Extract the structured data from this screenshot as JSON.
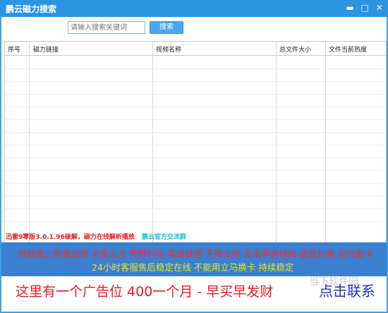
{
  "window": {
    "title": "鹏云磁力搜索",
    "minimize_glyph": "▬",
    "maximize_glyph": "□",
    "close_glyph": "✕"
  },
  "search": {
    "placeholder": "请输入搜索关键词",
    "button_label": "搜索"
  },
  "table": {
    "columns": [
      "序号",
      "磁力链接",
      "视频名称",
      "总文件大小",
      "文件当前热度"
    ],
    "rows": []
  },
  "info": {
    "version_note": "迅雷9零版3.0.1.96破解，磁力在线解析播放",
    "group_link": "鹏云官方交流群"
  },
  "banner": {
    "line1": "终结者2  刺激战场  全军出击  荒野行动  英雄联盟  无限法则  安卓手游辅助-最低价格  总代批卡",
    "line2": "24小时客服售后稳定在线    不能用立马换卡  持续稳定"
  },
  "ad": {
    "text": "这里有一个广告位  400一个月   - 早买早发财",
    "contact": "点击联系",
    "watermark": "当下软件园"
  }
}
